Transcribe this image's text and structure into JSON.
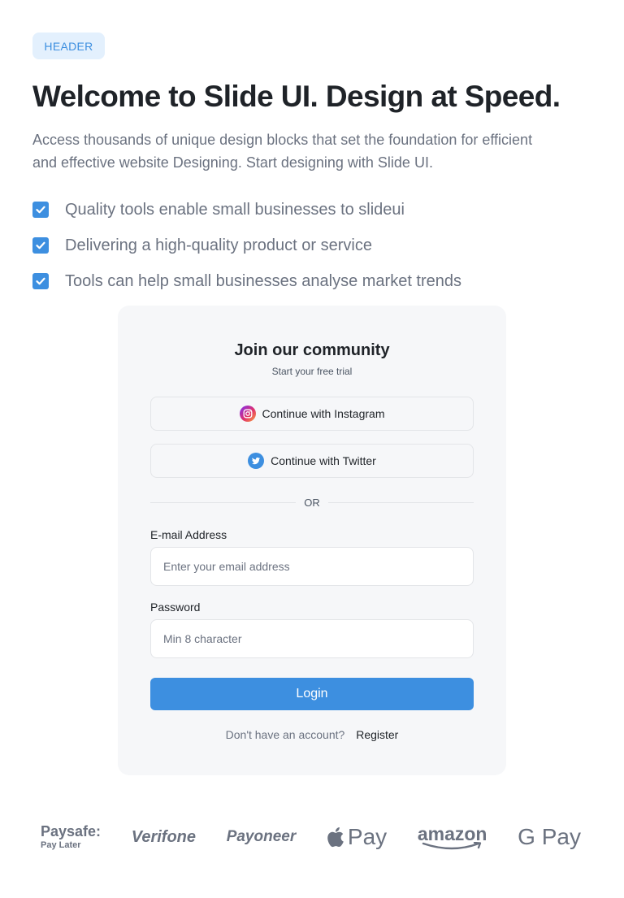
{
  "header": {
    "badge": "HEADER",
    "title": "Welcome to Slide UI. Design at Speed.",
    "lead": "Access thousands of unique design blocks that set the foundation for efficient and effective website Designing. Start designing with Slide UI."
  },
  "features": [
    {
      "label": "Quality tools enable small businesses to slideui",
      "checked": true
    },
    {
      "label": "Delivering a high-quality product or service",
      "checked": true
    },
    {
      "label": "Tools can help small businesses analyse market trends",
      "checked": true
    }
  ],
  "signup": {
    "title": "Join our community",
    "subtitle": "Start your free trial",
    "instagram_label": "Continue with Instagram",
    "twitter_label": "Continue with Twitter",
    "divider": "OR",
    "email_label": "E-mail Address",
    "email_placeholder": "Enter your email address",
    "email_value": "",
    "password_label": "Password",
    "password_placeholder": "Min 8 character",
    "password_value": "",
    "login_label": "Login",
    "no_account": "Don't have an account?",
    "register_label": "Register"
  },
  "partners": {
    "paysafe": "Paysafe:",
    "paysafe_sub": "Pay Later",
    "verifone": "Verifone",
    "payoneer": "Payoneer",
    "applepay": "Pay",
    "amazon": "amazon",
    "gpay": "G Pay"
  },
  "colors": {
    "accent": "#3d8fe0",
    "badge_bg": "#e3f0fd",
    "card_bg": "#f6f7f9",
    "muted_text": "#6b7280",
    "logo_gray": "#6b7280"
  },
  "icons": {
    "feature_check": "checkbox-checked-icon",
    "instagram": "instagram-icon",
    "twitter": "twitter-icon",
    "apple": "apple-icon"
  }
}
